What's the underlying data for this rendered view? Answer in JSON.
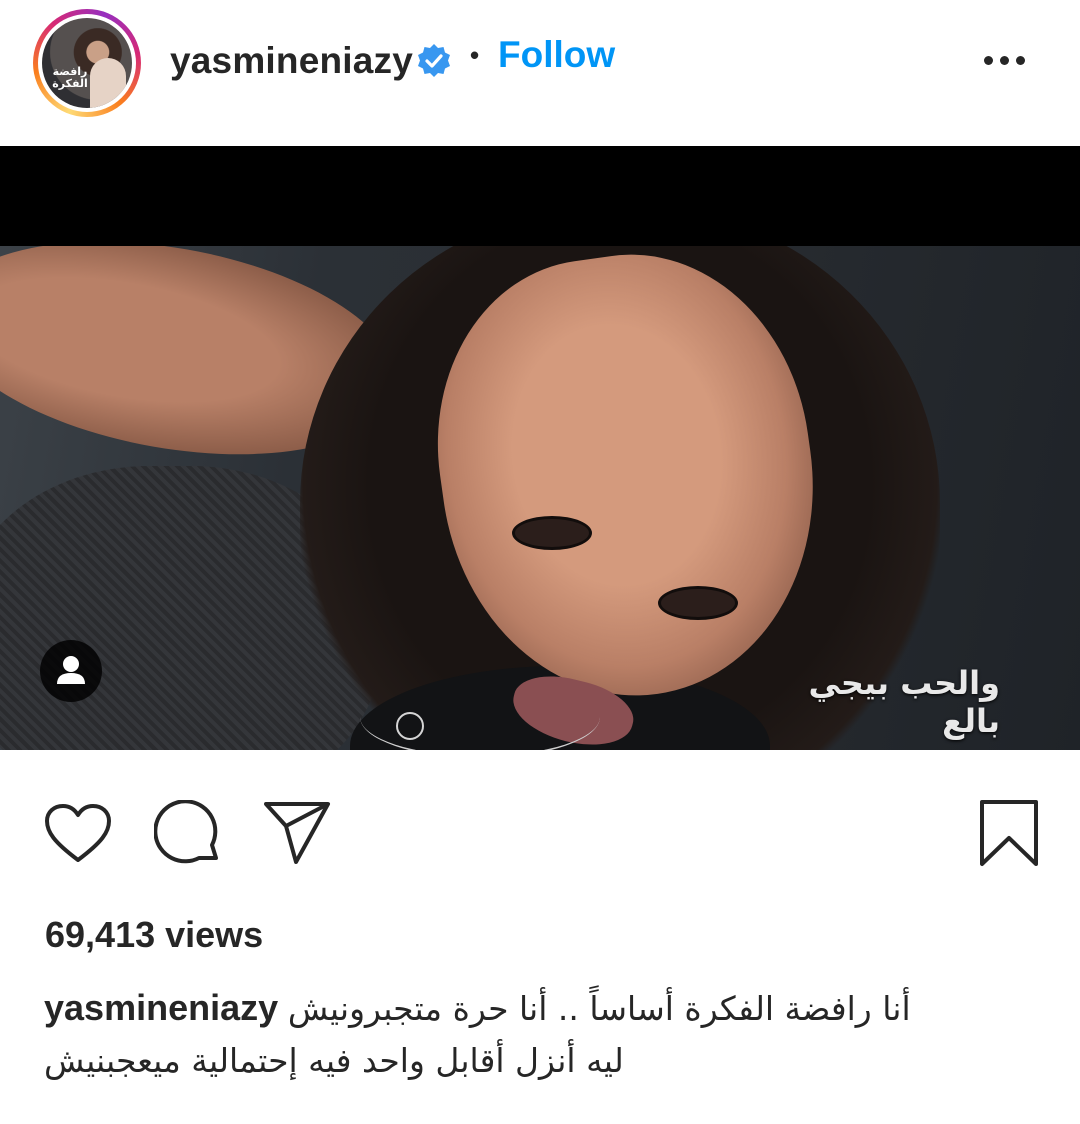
{
  "header": {
    "username": "yasmineniazy",
    "verified_icon": "verified-badge-icon",
    "separator": "•",
    "follow_label": "Follow",
    "more_icon": "more-options-icon",
    "avatar_text": "رافضة الفكرة"
  },
  "media": {
    "subtitle": "والحب بيجي بالع",
    "user_tag_icon": "person-icon"
  },
  "actions": {
    "like_icon": "heart-icon",
    "comment_icon": "comment-icon",
    "share_icon": "send-icon",
    "save_icon": "bookmark-icon"
  },
  "stats": {
    "views": "69,413 views"
  },
  "caption": {
    "username": "yasmineniazy",
    "line1": "أنا رافضة الفكرة أساساً .. أنا حرة متجبرونيش",
    "line2": "ليه أنزل أقابل واحد فيه إحتمالية ميعجبنيش"
  },
  "colors": {
    "accent": "#0095f6",
    "text": "#262626",
    "verified": "#3897f0"
  }
}
